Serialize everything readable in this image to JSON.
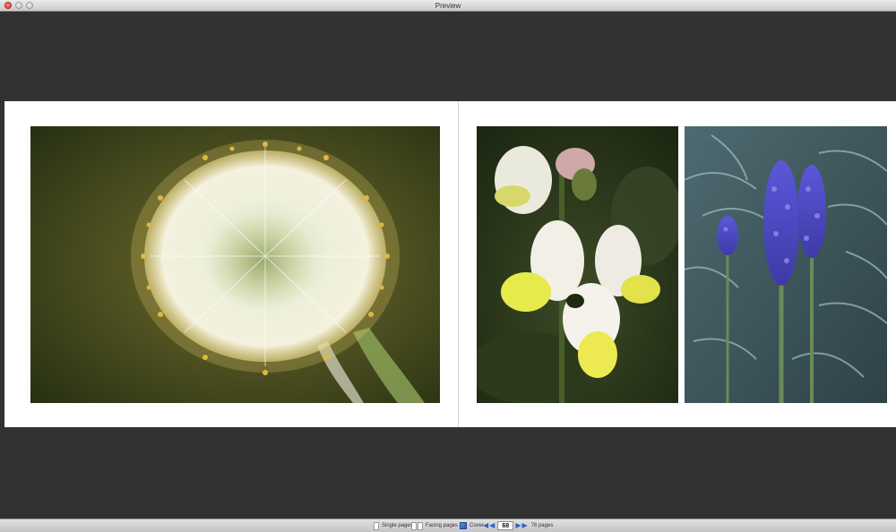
{
  "window": {
    "title": "Preview"
  },
  "photos": [
    {
      "name": "white-allium-flower"
    },
    {
      "name": "white-yellow-snapdragon"
    },
    {
      "name": "blue-echium-spikes"
    }
  ],
  "toolbar": {
    "single_pages_label": "Single pages",
    "facing_pages_label": "Facing pages",
    "cover_label": "Cover",
    "current_page": "68",
    "total_pages_label": "76 pages"
  },
  "colors": {
    "background": "#323232",
    "page": "#ffffff",
    "accent": "#2a64c0"
  }
}
